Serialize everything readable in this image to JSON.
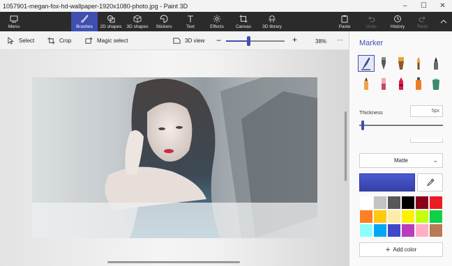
{
  "window": {
    "title": "1057901-megan-fox-hd-wallpaper-1920x1080-photo.jpg - Paint 3D",
    "minimize": "–",
    "maximize": "☐",
    "close": "✕"
  },
  "ribbon": {
    "menu": "Menu",
    "tools": [
      {
        "label": "Brushes",
        "icon": "brush-icon",
        "active": true
      },
      {
        "label": "2D shapes",
        "icon": "2d-shapes-icon"
      },
      {
        "label": "3D shapes",
        "icon": "3d-shapes-icon"
      },
      {
        "label": "Stickers",
        "icon": "stickers-icon"
      },
      {
        "label": "Text",
        "icon": "text-icon"
      },
      {
        "label": "Effects",
        "icon": "effects-icon"
      },
      {
        "label": "Canvas",
        "icon": "canvas-icon"
      },
      {
        "label": "3D library",
        "icon": "3d-library-icon"
      }
    ],
    "paste": "Paste",
    "undo": "Undo",
    "history": "History",
    "redo": "Redo",
    "accent": "#3f4fb0"
  },
  "toolbar": {
    "select": "Select",
    "crop": "Crop",
    "magic_select": "Magic select",
    "view_3d": "3D view",
    "zoom_percent": "38%",
    "zoom_level": 0.38,
    "more": "···"
  },
  "panel": {
    "title": "Marker",
    "thickness_label": "Thickness",
    "thickness_value": "5px",
    "finish": "Matte",
    "current_color": "#3f48cc",
    "add_color": "Add color",
    "swatches": [
      "#ffffff",
      "#c3c3c3",
      "#585858",
      "#000000",
      "#88001b",
      "#ec1c24",
      "#ff7f27",
      "#ffc90e",
      "#fdeca6",
      "#fff200",
      "#c4ff0e",
      "#0ed145",
      "#8cfffb",
      "#00a8f3",
      "#3f48cc",
      "#b83dba",
      "#ffaec8",
      "#b97a56"
    ]
  }
}
